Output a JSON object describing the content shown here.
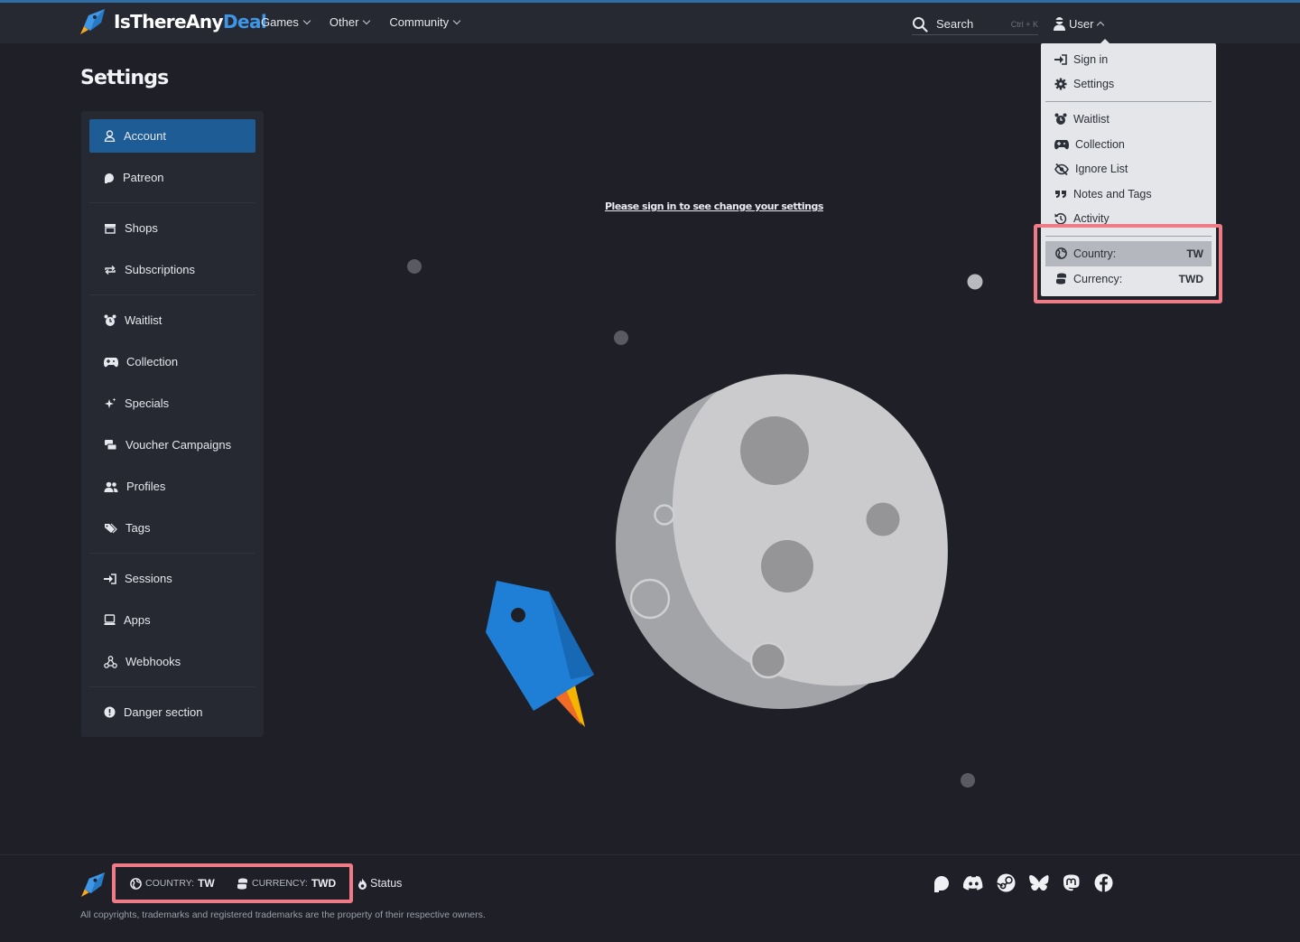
{
  "header": {
    "logo_text_main": "IsThereAny",
    "logo_text_accent": "Deal",
    "nav": [
      {
        "label": "Games"
      },
      {
        "label": "Other"
      },
      {
        "label": "Community"
      }
    ],
    "search_label": "Search",
    "search_shortcut": "Ctrl + K",
    "user_label": "User"
  },
  "user_menu": {
    "items_account": [
      {
        "label": "Sign in",
        "icon": "sign-in-icon"
      },
      {
        "label": "Settings",
        "icon": "gear-icon"
      }
    ],
    "items_lists": [
      {
        "label": "Waitlist",
        "icon": "alarm-clock-icon"
      },
      {
        "label": "Collection",
        "icon": "gamepad-icon"
      },
      {
        "label": "Ignore List",
        "icon": "eye-slash-icon"
      },
      {
        "label": "Notes and Tags",
        "icon": "quote-icon"
      },
      {
        "label": "Activity",
        "icon": "history-icon"
      }
    ],
    "country_label": "Country:",
    "country_value": "TW",
    "currency_label": "Currency:",
    "currency_value": "TWD"
  },
  "page": {
    "title": "Settings",
    "signin_message": "Please sign in to see change your settings"
  },
  "sidebar": {
    "groups": [
      [
        {
          "label": "Account",
          "icon": "user-icon",
          "active": true
        },
        {
          "label": "Patreon",
          "icon": "patreon-icon"
        }
      ],
      [
        {
          "label": "Shops",
          "icon": "shop-icon"
        },
        {
          "label": "Subscriptions",
          "icon": "repeat-icon"
        }
      ],
      [
        {
          "label": "Waitlist",
          "icon": "alarm-clock-icon"
        },
        {
          "label": "Collection",
          "icon": "gamepad-icon"
        },
        {
          "label": "Specials",
          "icon": "sparkles-icon"
        },
        {
          "label": "Voucher Campaigns",
          "icon": "voucher-icon"
        },
        {
          "label": "Profiles",
          "icon": "users-icon"
        },
        {
          "label": "Tags",
          "icon": "tags-icon"
        }
      ],
      [
        {
          "label": "Sessions",
          "icon": "sign-in-icon"
        },
        {
          "label": "Apps",
          "icon": "laptop-icon"
        },
        {
          "label": "Webhooks",
          "icon": "webhook-icon"
        }
      ],
      [
        {
          "label": "Danger section",
          "icon": "exclamation-circle-icon"
        }
      ]
    ]
  },
  "footer": {
    "country_label": "COUNTRY:",
    "country_value": "TW",
    "currency_label": "CURRENCY:",
    "currency_value": "TWD",
    "status_label": "Status",
    "copyright": "All copyrights, trademarks and registered trademarks are the property of their respective owners.",
    "socials": [
      "patreon-icon",
      "discord-icon",
      "steam-icon",
      "bluesky-icon",
      "mastodon-icon",
      "facebook-icon"
    ]
  },
  "colors": {
    "background": "#1e1f27",
    "topbar": "#262832",
    "accent_blue": "#3d96e6",
    "active_item": "#1d5c94",
    "highlight_box": "#ef7b86",
    "dropdown_bg": "#e4e6ea"
  }
}
